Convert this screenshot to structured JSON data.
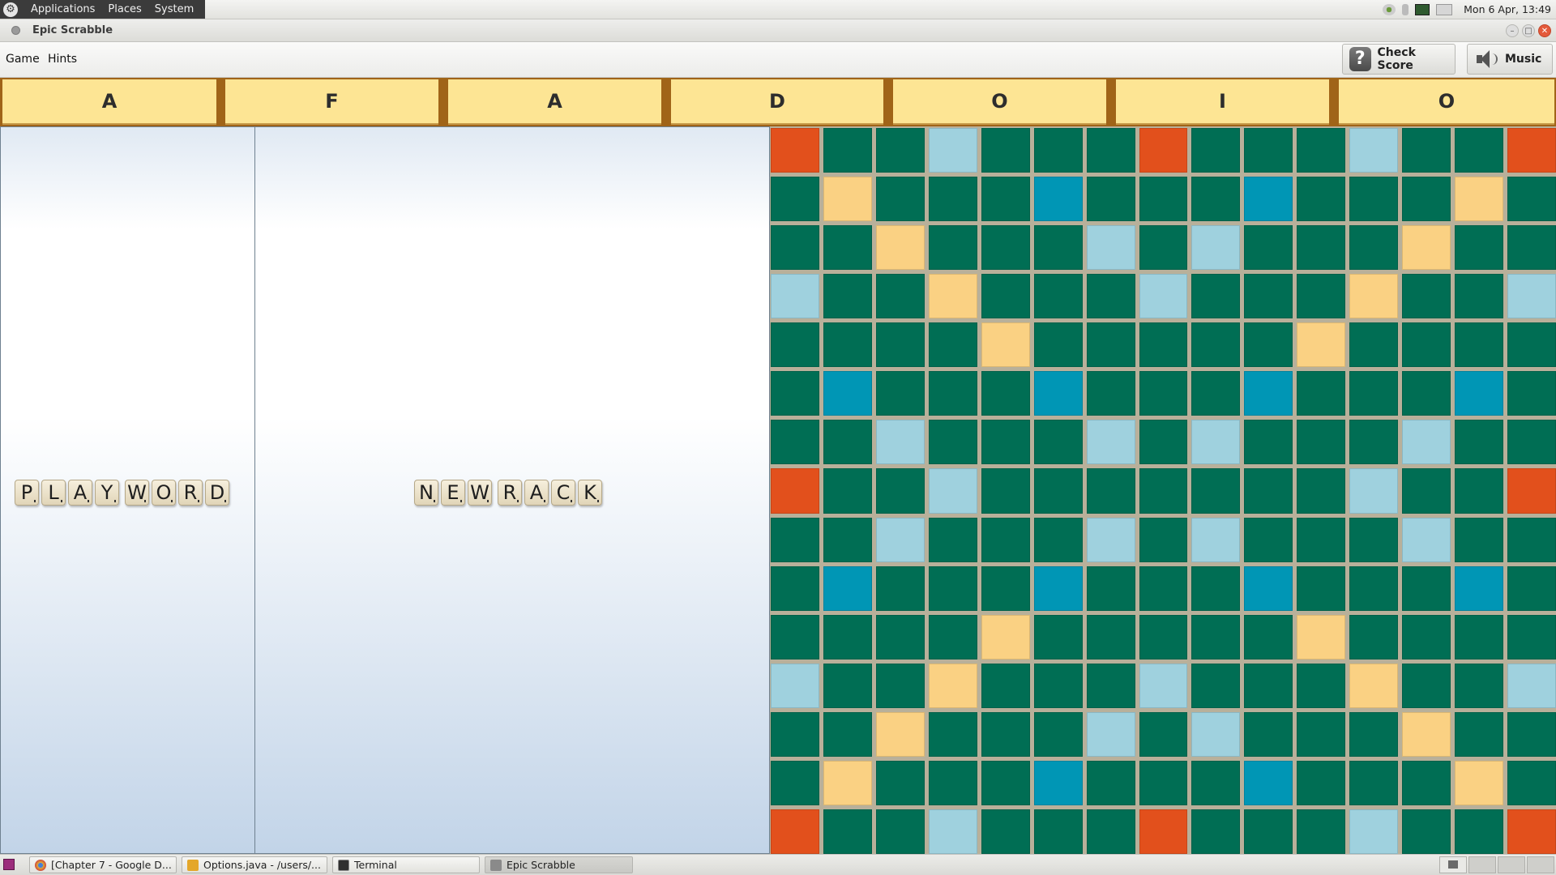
{
  "top_panel": {
    "menus": [
      "Applications",
      "Places",
      "System"
    ],
    "clock": "Mon 6 Apr, 13:49"
  },
  "window": {
    "title": "Epic Scrabble"
  },
  "menubar": {
    "game": "Game",
    "hints": "Hints"
  },
  "toolbar": {
    "check_score": "Check Score",
    "music": "Music"
  },
  "rack": {
    "letters": [
      "A",
      "F",
      "A",
      "D",
      "O",
      "I",
      "O"
    ]
  },
  "play_word": {
    "tiles": [
      "P",
      "L",
      "A",
      "Y",
      "W",
      "O",
      "R",
      "D"
    ]
  },
  "new_rack": {
    "tiles": [
      "N",
      "E",
      "W",
      "R",
      "A",
      "C",
      "K"
    ]
  },
  "board": {
    "size": 15,
    "legend": {
      "n": "normal",
      "tw": "triple-word",
      "dw": "double-word",
      "dl": "double-letter",
      "tl": "triple-letter"
    },
    "colors": {
      "normal": "#006e54",
      "triple_word": "#e2501c",
      "double_word": "#fad183",
      "double_letter": "#9fd1de",
      "triple_letter": "#0096b5"
    },
    "rows": [
      [
        "tw",
        "n",
        "n",
        "dl",
        "n",
        "n",
        "n",
        "tw",
        "n",
        "n",
        "n",
        "dl",
        "n",
        "n",
        "tw"
      ],
      [
        "n",
        "dw",
        "n",
        "n",
        "n",
        "tl",
        "n",
        "n",
        "n",
        "tl",
        "n",
        "n",
        "n",
        "dw",
        "n"
      ],
      [
        "n",
        "n",
        "dw",
        "n",
        "n",
        "n",
        "dl",
        "n",
        "dl",
        "n",
        "n",
        "n",
        "dw",
        "n",
        "n"
      ],
      [
        "dl",
        "n",
        "n",
        "dw",
        "n",
        "n",
        "n",
        "dl",
        "n",
        "n",
        "n",
        "dw",
        "n",
        "n",
        "dl"
      ],
      [
        "n",
        "n",
        "n",
        "n",
        "dw",
        "n",
        "n",
        "n",
        "n",
        "n",
        "dw",
        "n",
        "n",
        "n",
        "n"
      ],
      [
        "n",
        "tl",
        "n",
        "n",
        "n",
        "tl",
        "n",
        "n",
        "n",
        "tl",
        "n",
        "n",
        "n",
        "tl",
        "n"
      ],
      [
        "n",
        "n",
        "dl",
        "n",
        "n",
        "n",
        "dl",
        "n",
        "dl",
        "n",
        "n",
        "n",
        "dl",
        "n",
        "n"
      ],
      [
        "tw",
        "n",
        "n",
        "dl",
        "n",
        "n",
        "n",
        "n",
        "n",
        "n",
        "n",
        "dl",
        "n",
        "n",
        "tw"
      ],
      [
        "n",
        "n",
        "dl",
        "n",
        "n",
        "n",
        "dl",
        "n",
        "dl",
        "n",
        "n",
        "n",
        "dl",
        "n",
        "n"
      ],
      [
        "n",
        "tl",
        "n",
        "n",
        "n",
        "tl",
        "n",
        "n",
        "n",
        "tl",
        "n",
        "n",
        "n",
        "tl",
        "n"
      ],
      [
        "n",
        "n",
        "n",
        "n",
        "dw",
        "n",
        "n",
        "n",
        "n",
        "n",
        "dw",
        "n",
        "n",
        "n",
        "n"
      ],
      [
        "dl",
        "n",
        "n",
        "dw",
        "n",
        "n",
        "n",
        "dl",
        "n",
        "n",
        "n",
        "dw",
        "n",
        "n",
        "dl"
      ],
      [
        "n",
        "n",
        "dw",
        "n",
        "n",
        "n",
        "dl",
        "n",
        "dl",
        "n",
        "n",
        "n",
        "dw",
        "n",
        "n"
      ],
      [
        "n",
        "dw",
        "n",
        "n",
        "n",
        "tl",
        "n",
        "n",
        "n",
        "tl",
        "n",
        "n",
        "n",
        "dw",
        "n"
      ],
      [
        "tw",
        "n",
        "n",
        "dl",
        "n",
        "n",
        "n",
        "tw",
        "n",
        "n",
        "n",
        "dl",
        "n",
        "n",
        "tw"
      ]
    ]
  },
  "taskbar": {
    "tasks": [
      {
        "label": "[Chapter 7 - Google D...",
        "icon": "chrome-icon"
      },
      {
        "label": "Options.java - /users/...",
        "icon": "java-file-icon"
      },
      {
        "label": "Terminal",
        "icon": "terminal-icon"
      },
      {
        "label": "Epic Scrabble",
        "icon": "java-app-icon"
      }
    ]
  }
}
